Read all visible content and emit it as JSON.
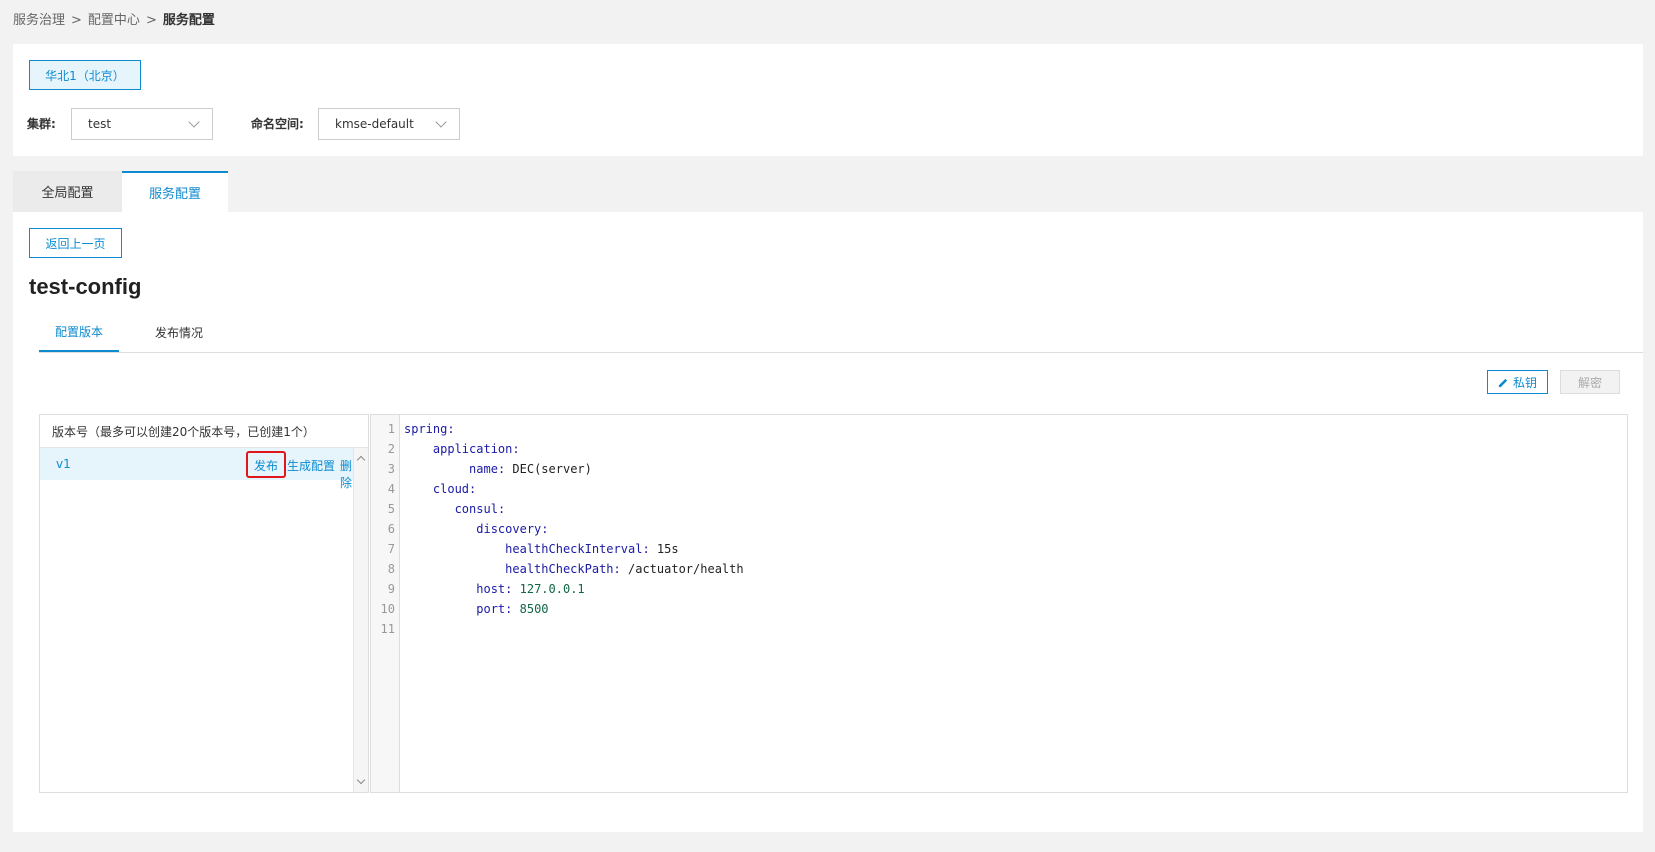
{
  "breadcrumb": {
    "items": [
      "服务治理",
      "配置中心"
    ],
    "separator": ">",
    "current": "服务配置"
  },
  "region": {
    "label": "华北1（北京）"
  },
  "filters": {
    "cluster": {
      "label": "集群:",
      "value": "test"
    },
    "namespace": {
      "label": "命名空间:",
      "value": "kmse-default"
    }
  },
  "tabs": [
    {
      "label": "全局配置",
      "active": false
    },
    {
      "label": "服务配置",
      "active": true
    }
  ],
  "back_button": "返回上一页",
  "title": "test-config",
  "subtabs": [
    {
      "label": "配置版本",
      "active": true
    },
    {
      "label": "发布情况",
      "active": false
    }
  ],
  "toolbar": {
    "private_key": "私钥",
    "decrypt": "解密"
  },
  "versions": {
    "header": "版本号（最多可以创建20个版本号，已创建1个）",
    "rows": [
      {
        "name": "v1",
        "actions": {
          "publish": "发布",
          "generate": "生成配置",
          "delete": "删除"
        }
      }
    ]
  },
  "editor": {
    "lines": [
      {
        "num": "1",
        "indent": "",
        "key": "spring",
        "value": "",
        "value_type": ""
      },
      {
        "num": "2",
        "indent": "    ",
        "key": "application",
        "value": "",
        "value_type": ""
      },
      {
        "num": "3",
        "indent": "         ",
        "key": "name",
        "value": "DEC(server)",
        "value_type": "str"
      },
      {
        "num": "4",
        "indent": "    ",
        "key": "cloud",
        "value": "",
        "value_type": ""
      },
      {
        "num": "5",
        "indent": "       ",
        "key": "consul",
        "value": "",
        "value_type": ""
      },
      {
        "num": "6",
        "indent": "          ",
        "key": "discovery",
        "value": "",
        "value_type": ""
      },
      {
        "num": "7",
        "indent": "              ",
        "key": "healthCheckInterval",
        "value": "15s",
        "value_type": "str"
      },
      {
        "num": "8",
        "indent": "              ",
        "key": "healthCheckPath",
        "value": "/actuator/health",
        "value_type": "str"
      },
      {
        "num": "9",
        "indent": "          ",
        "key": "host",
        "value": "127.0.0.1",
        "value_type": "num"
      },
      {
        "num": "10",
        "indent": "          ",
        "key": "port",
        "value": "8500",
        "value_type": "num"
      },
      {
        "num": "11",
        "indent": "",
        "key": "",
        "value": "",
        "value_type": ""
      }
    ]
  },
  "colors": {
    "accent": "#0e8bd0",
    "highlight": "#e0161b"
  }
}
